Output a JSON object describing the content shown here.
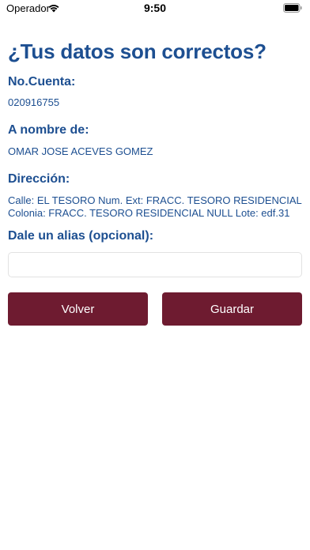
{
  "status_bar": {
    "carrier": "Operador",
    "time": "9:50",
    "icons": [
      "wifi-icon",
      "battery-icon"
    ]
  },
  "page": {
    "title": "¿Tus datos son correctos?"
  },
  "account": {
    "label": "No.Cuenta:",
    "value": "020916755"
  },
  "holder": {
    "label": "A nombre de:",
    "value": "OMAR JOSE ACEVES GOMEZ"
  },
  "address": {
    "label": "Dirección:",
    "line1": "Calle: EL TESORO  Num. Ext: FRACC. TESORO RESIDENCIAL",
    "line2": "Colonia: FRACC. TESORO RESIDENCIAL NULL Lote: edf.31"
  },
  "alias": {
    "label": "Dale un alias (opcional):",
    "value": "",
    "placeholder": ""
  },
  "actions": {
    "back_label": "Volver",
    "save_label": "Guardar"
  },
  "colors": {
    "heading": "#1d4f91",
    "button": "#6e1b30",
    "button_text": "#ffffff"
  }
}
